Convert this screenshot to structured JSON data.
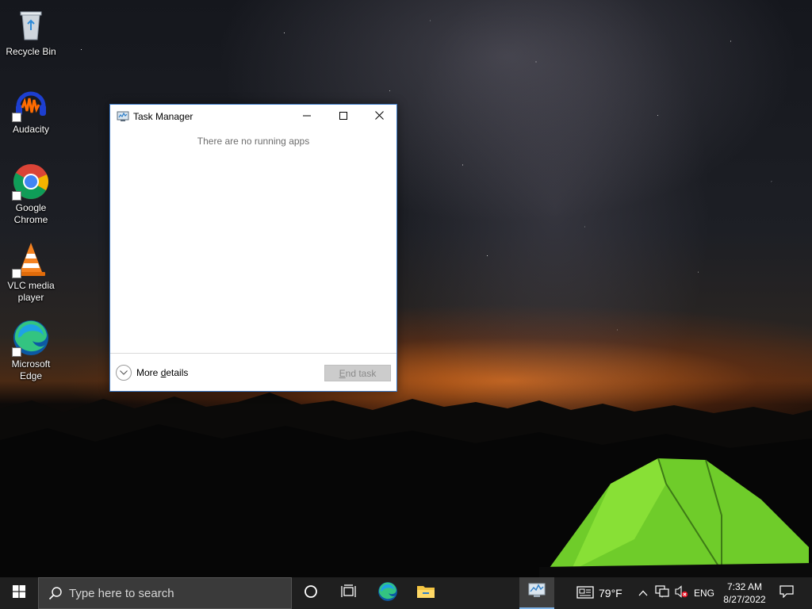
{
  "desktop": {
    "icons": [
      {
        "label": "Recycle Bin"
      },
      {
        "label": "Audacity"
      },
      {
        "label": "Google Chrome"
      },
      {
        "label": "VLC media player"
      },
      {
        "label": "Microsoft Edge"
      }
    ]
  },
  "task_manager": {
    "title": "Task Manager",
    "empty_message": "There are no running apps",
    "more_details_label_pre": "More ",
    "more_details_label_underlined": "d",
    "more_details_label_post": "etails",
    "end_task_label_underlined": "E",
    "end_task_label_rest": "nd task",
    "end_task_enabled": false
  },
  "taskbar": {
    "search_placeholder": "Type here to search",
    "weather": "79°F",
    "language": "ENG",
    "time": "7:32 AM",
    "date": "8/27/2022",
    "pinned": [
      "cortana",
      "task-view",
      "microsoft-edge",
      "file-explorer"
    ],
    "active_app": "task-manager"
  },
  "colors": {
    "taskbar_bg": "#1f1f1f",
    "window_border": "#3b78c4",
    "end_task_disabled_bg": "#cccccc"
  }
}
